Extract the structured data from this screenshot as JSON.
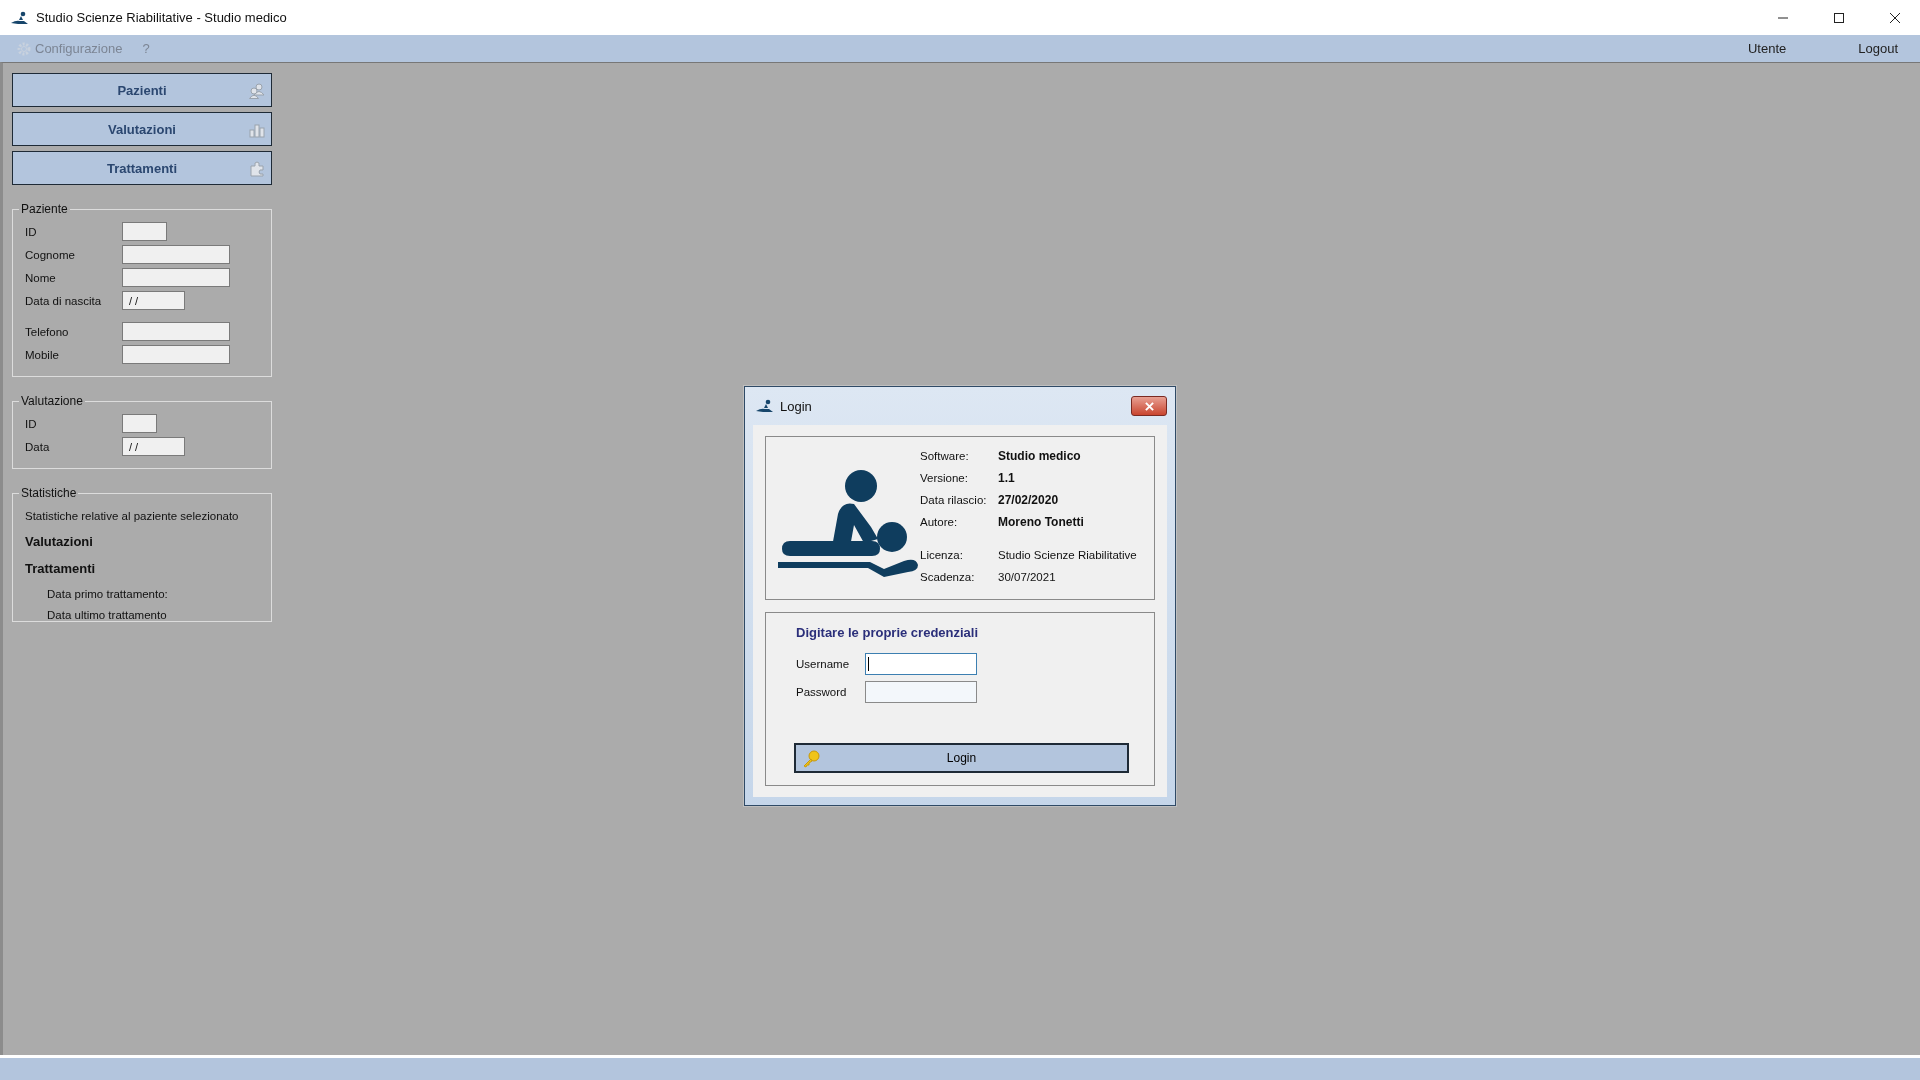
{
  "window": {
    "title": "Studio Scienze Riabilitative - Studio medico"
  },
  "menu": {
    "items": [
      {
        "label": "Configurazione",
        "kind": "gear",
        "disabled": true
      },
      {
        "label": "?",
        "kind": "plain",
        "disabled": true
      }
    ],
    "right_items": [
      "Utente",
      "Logout"
    ]
  },
  "sidebar": {
    "nav_buttons": [
      {
        "label": "Pazienti",
        "kind": "people"
      },
      {
        "label": "Valutazioni",
        "kind": "chart"
      },
      {
        "label": "Trattamenti",
        "kind": "puzzle"
      }
    ],
    "groups": [
      {
        "title": "Paziente",
        "fields": [
          {
            "label": "ID",
            "kind": "short"
          },
          {
            "label": "Cognome",
            "kind": "long"
          },
          {
            "label": "Nome",
            "kind": "long"
          },
          {
            "label": "Data di nascita",
            "kind": "date",
            "value": "/ /"
          },
          {
            "label": "Telefono",
            "kind": "long",
            "gap": true
          },
          {
            "label": "Mobile",
            "kind": "long"
          }
        ]
      },
      {
        "title": "Valutazione",
        "fields": [
          {
            "label": "ID",
            "kind": "mini"
          },
          {
            "label": "Data",
            "kind": "date",
            "value": "/ /"
          }
        ]
      }
    ],
    "statistiche": {
      "title": "Statistiche",
      "description": "Statistiche relative al paziente selezionato",
      "headings": [
        "Valutazioni",
        "Trattamenti"
      ],
      "details": [
        "Data primo trattamento:",
        "Data ultimo trattamento"
      ]
    }
  },
  "login_dialog": {
    "title": "Login",
    "info_groups": [
      [
        {
          "label": "Software:",
          "value": "Studio medico",
          "bold": true
        },
        {
          "label": "Versione:",
          "value": "1.1",
          "bold": true
        },
        {
          "label": "Data rilascio:",
          "value": "27/02/2020",
          "bold": true
        },
        {
          "label": "Autore:",
          "value": "Moreno Tonetti",
          "bold": true
        }
      ],
      [
        {
          "label": "Licenza:",
          "value": "Studio Scienze Riabilitative",
          "bold": false
        },
        {
          "label": "Scadenza:",
          "value": "30/07/2021",
          "bold": false
        }
      ]
    ],
    "heading": "Digitare le proprie credenziali",
    "fields": [
      {
        "label": "Username",
        "focused": true
      },
      {
        "label": "Password",
        "focused": false
      }
    ],
    "button": "Login"
  }
}
